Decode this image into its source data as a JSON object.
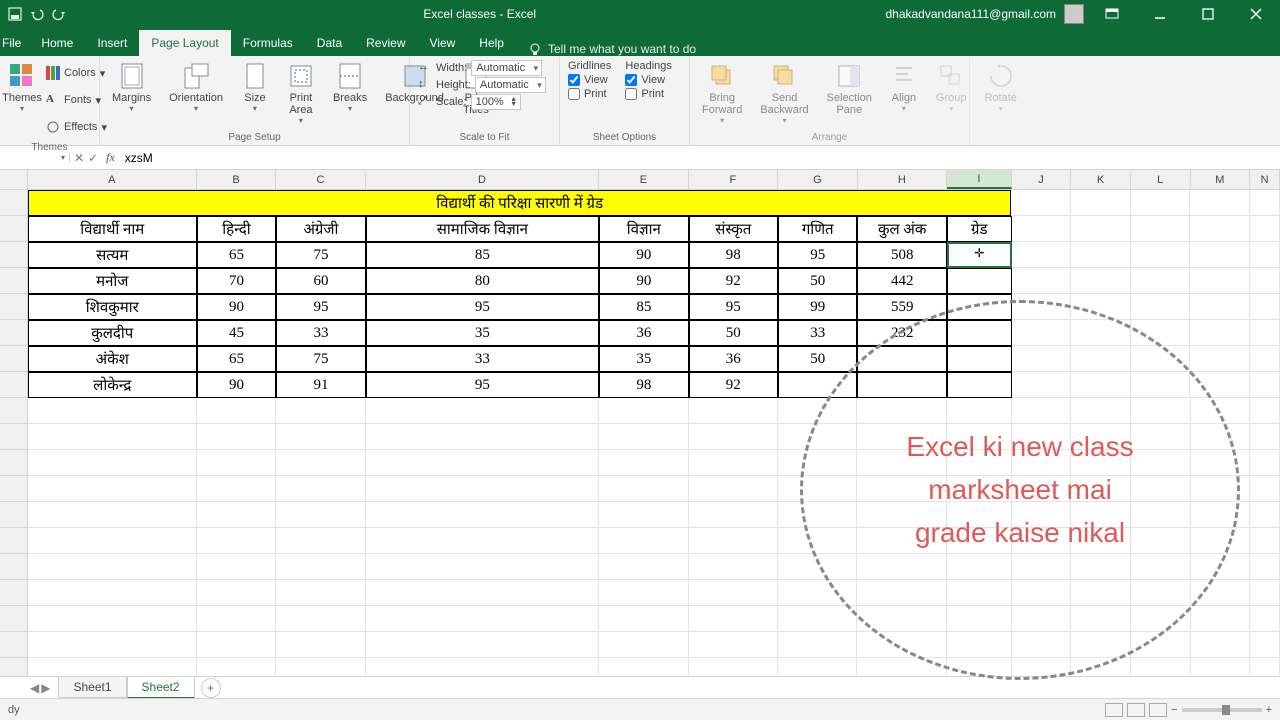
{
  "titlebar": {
    "title": "Excel classes - Excel",
    "user_email": "dhakadvandana111@gmail.com"
  },
  "tabs": {
    "file": "File",
    "home": "Home",
    "insert": "Insert",
    "page_layout": "Page Layout",
    "formulas": "Formulas",
    "data": "Data",
    "review": "Review",
    "view": "View",
    "help": "Help",
    "tellme": "Tell me what you want to do"
  },
  "ribbon": {
    "themes": {
      "label": "Themes",
      "colors": "Colors",
      "fonts": "Fonts",
      "effects": "Effects",
      "btn": "Themes"
    },
    "page_setup": {
      "label": "Page Setup",
      "margins": "Margins",
      "orientation": "Orientation",
      "size": "Size",
      "print_area": "Print\nArea",
      "breaks": "Breaks",
      "background": "Background",
      "print_titles": "Print\nTitles"
    },
    "scale": {
      "label": "Scale to Fit",
      "width": "Width:",
      "width_val": "Automatic",
      "height": "Height:",
      "height_val": "Automatic",
      "scale": "Scale:",
      "scale_val": "100%"
    },
    "sheet_options": {
      "label": "Sheet Options",
      "gridlines": "Gridlines",
      "headings": "Headings",
      "view": "View",
      "print": "Print"
    },
    "arrange": {
      "label": "Arrange",
      "bring_forward": "Bring\nForward",
      "send_backward": "Send\nBackward",
      "selection_pane": "Selection\nPane",
      "align": "Align",
      "group": "Group",
      "rotate": "Rotate"
    }
  },
  "formula_bar": {
    "namebox": "",
    "value": "xzsM"
  },
  "columns": [
    "A",
    "B",
    "C",
    "D",
    "E",
    "F",
    "G",
    "H",
    "I",
    "J",
    "K",
    "L",
    "M",
    "N"
  ],
  "sheet": {
    "title": "विद्यार्थी की परिक्षा सारणी में ग्रेड",
    "headers": [
      "विद्यार्थी नाम",
      "हिन्दी",
      "अंग्रेजी",
      "सामाजिक विज्ञान",
      "विज्ञान",
      "संस्कृत",
      "गणित",
      "कुल अंक",
      "ग्रेड"
    ],
    "rows": [
      {
        "name": "सत्यम",
        "v": [
          "65",
          "75",
          "85",
          "90",
          "98",
          "95",
          "508",
          ""
        ]
      },
      {
        "name": "मनोज",
        "v": [
          "70",
          "60",
          "80",
          "90",
          "92",
          "50",
          "442",
          ""
        ]
      },
      {
        "name": "शिवकुमार",
        "v": [
          "90",
          "95",
          "95",
          "85",
          "95",
          "99",
          "559",
          ""
        ]
      },
      {
        "name": "कुलदीप",
        "v": [
          "45",
          "33",
          "35",
          "36",
          "50",
          "33",
          "232",
          ""
        ]
      },
      {
        "name": "अंकेश",
        "v": [
          "65",
          "75",
          "33",
          "35",
          "36",
          "50",
          "",
          ""
        ]
      },
      {
        "name": "लोकेन्द्र",
        "v": [
          "90",
          "91",
          "95",
          "98",
          "92",
          "",
          "",
          ""
        ]
      }
    ]
  },
  "sheets": {
    "s1": "Sheet1",
    "s2": "Sheet2"
  },
  "statusbar": {
    "ready": "dy",
    "zoom": "100%"
  },
  "annotation": {
    "l1": "Excel ki new class",
    "l2": "marksheet mai",
    "l3": "grade kaise nikal"
  }
}
